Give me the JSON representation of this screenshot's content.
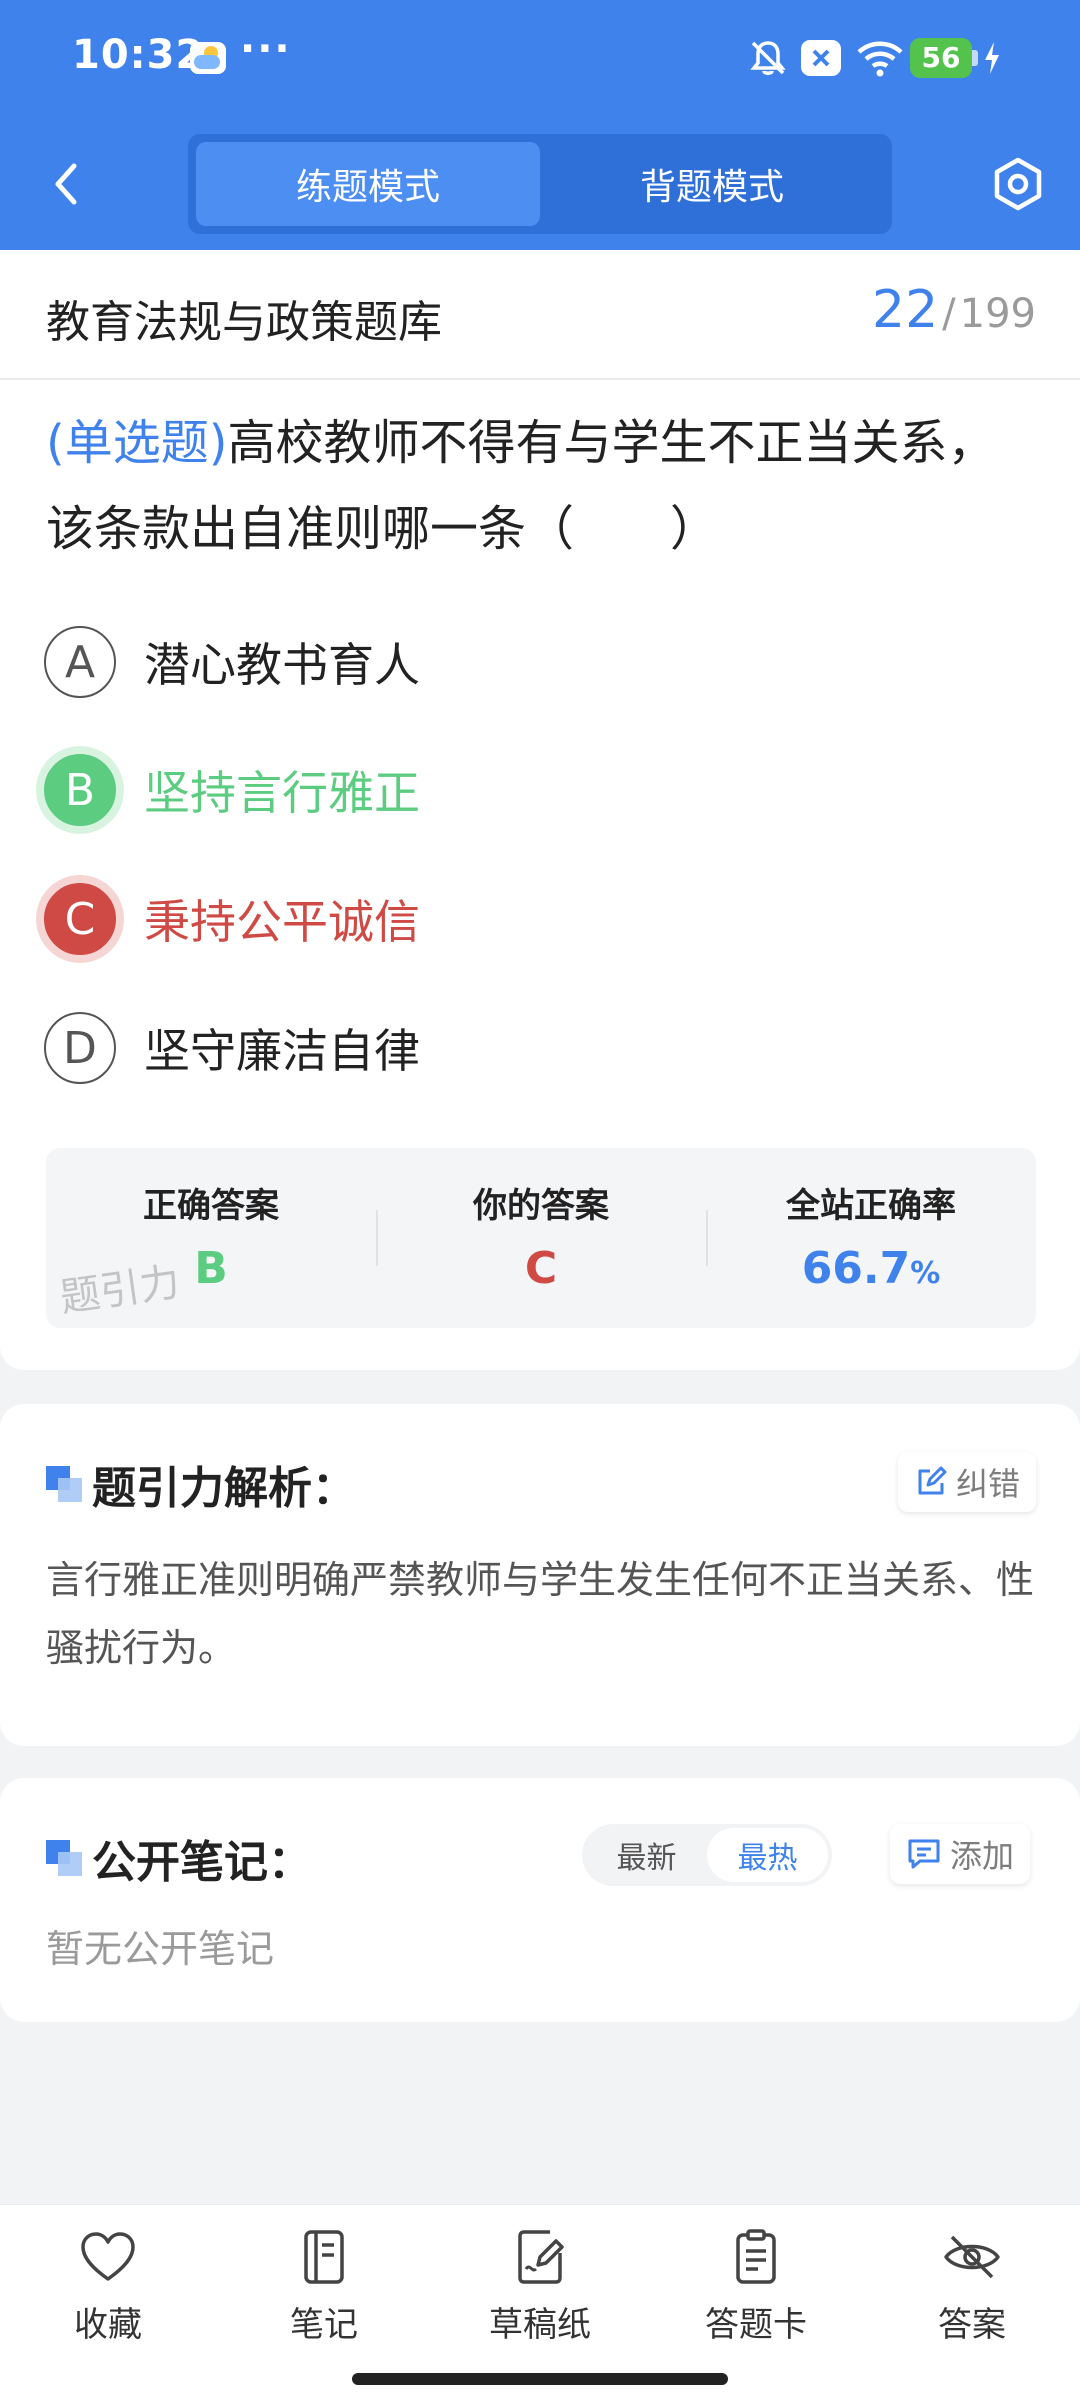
{
  "status_bar": {
    "time": "10:32",
    "dots": "···",
    "battery": "56"
  },
  "header": {
    "tabs": [
      {
        "label": "练题模式",
        "active": true
      },
      {
        "label": "背题模式",
        "active": false
      }
    ]
  },
  "bank": {
    "title": "教育法规与政策题库",
    "current": "22",
    "separator": "/",
    "total": "199"
  },
  "question": {
    "type_tag": "(单选题)",
    "text": "高校教师不得有与学生不正当关系，该条款出自准则哪一条（　　）"
  },
  "options": [
    {
      "letter": "A",
      "text": "潜心教书育人",
      "state": "normal"
    },
    {
      "letter": "B",
      "text": "坚持言行雅正",
      "state": "correct"
    },
    {
      "letter": "C",
      "text": "秉持公平诚信",
      "state": "wrong"
    },
    {
      "letter": "D",
      "text": "坚守廉洁自律",
      "state": "normal"
    }
  ],
  "stats": {
    "correct_label": "正确答案",
    "correct_value": "B",
    "yours_label": "你的答案",
    "yours_value": "C",
    "rate_label": "全站正确率",
    "rate_value": "66.7",
    "rate_unit": "%",
    "watermark": "题引力"
  },
  "analysis": {
    "title": "题引力解析：",
    "report_label": "纠错",
    "text": "言行雅正准则明确严禁教师与学生发生任何不正当关系、性骚扰行为。"
  },
  "notes": {
    "title": "公开笔记：",
    "sort_options": [
      "最新",
      "最热"
    ],
    "active_sort": "最热",
    "add_label": "添加",
    "empty": "暂无公开笔记"
  },
  "bottom_nav": [
    {
      "label": "收藏",
      "icon": "heart-icon"
    },
    {
      "label": "笔记",
      "icon": "notebook-icon"
    },
    {
      "label": "草稿纸",
      "icon": "draft-paper-icon"
    },
    {
      "label": "答题卡",
      "icon": "answer-sheet-icon"
    },
    {
      "label": "答案",
      "icon": "eye-off-icon"
    }
  ],
  "colors": {
    "primary": "#3f82ec",
    "correct": "#5ccc80",
    "wrong": "#cf4a45"
  }
}
